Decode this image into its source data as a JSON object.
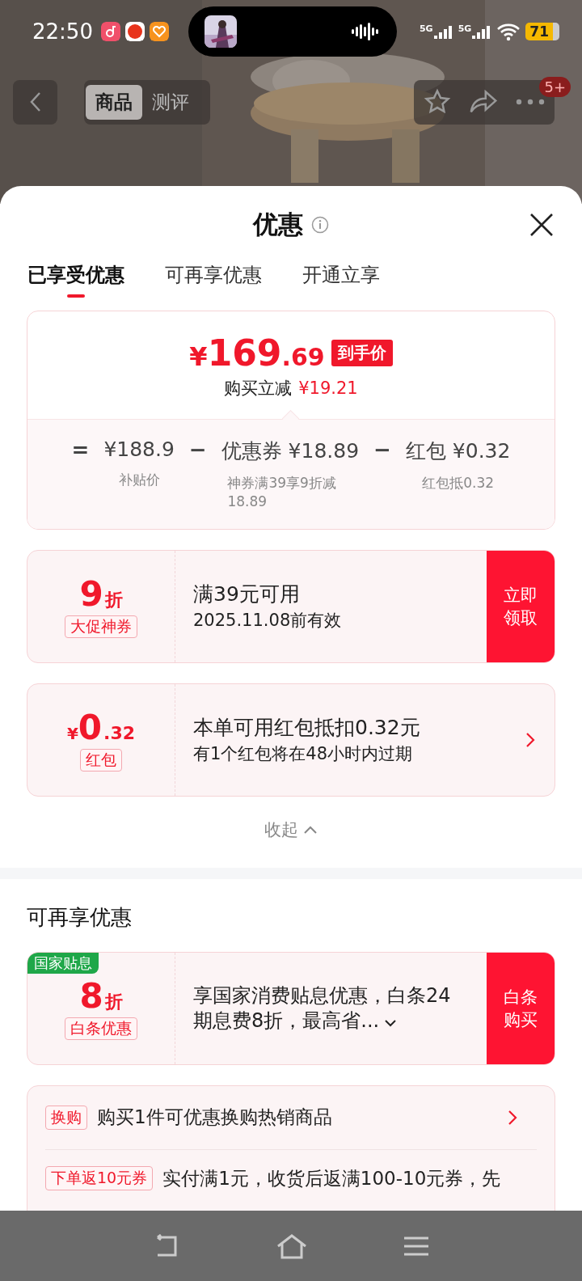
{
  "status_bar": {
    "time": "22:50",
    "networks": [
      "5G",
      "5G"
    ],
    "battery": "71"
  },
  "top_nav": {
    "tabs": [
      {
        "label": "商品",
        "selected": true
      },
      {
        "label": "测评",
        "selected": false
      }
    ],
    "badge": "5+"
  },
  "sheet": {
    "title": "优惠",
    "tabs": [
      {
        "label": "已享受优惠",
        "selected": true
      },
      {
        "label": "可再享优惠",
        "selected": false
      },
      {
        "label": "开通立享",
        "selected": false
      }
    ],
    "price_card": {
      "currency": "¥",
      "price_int": "169",
      "price_dec": ".69",
      "tag": "到手价",
      "reduction_label": "购买立减",
      "reduction": "¥19.21",
      "breakdown": [
        {
          "operator": "=",
          "amount": "¥188.9",
          "note": "补贴价"
        },
        {
          "operator": "−",
          "amount": "优惠券 ¥18.89",
          "note": "神券满39享9折减18.89"
        },
        {
          "operator": "−",
          "amount": "红包 ¥0.32",
          "note": "红包抵0.32"
        }
      ]
    },
    "coupons": [
      {
        "kind": "claim",
        "value": "9",
        "unit": "折",
        "tag": "大促神券",
        "title": "满39元可用",
        "subtitle": "2025.11.08前有效",
        "action": "立即领取"
      },
      {
        "kind": "arrow",
        "prefix": "¥",
        "value": "0",
        "unit": ".32",
        "tag": "红包",
        "title": "本单可用红包抵扣0.32元",
        "subtitle": "有1个红包将在48小时内过期"
      }
    ],
    "collapse": "收起",
    "more": {
      "title": "可再享优惠",
      "card": {
        "corner_tag": "国家贴息",
        "value": "8",
        "unit": "折",
        "tag": "白条优惠",
        "text": "享国家消费贴息优惠，白条24期息费8折，最高省...",
        "action": "白条购买"
      },
      "list": [
        {
          "tag": "换购",
          "text": "购买1件可优惠换购热销商品"
        },
        {
          "tag": "下单返10元券",
          "text": "实付满1元，收货后返满100-10元券，先"
        }
      ]
    }
  }
}
